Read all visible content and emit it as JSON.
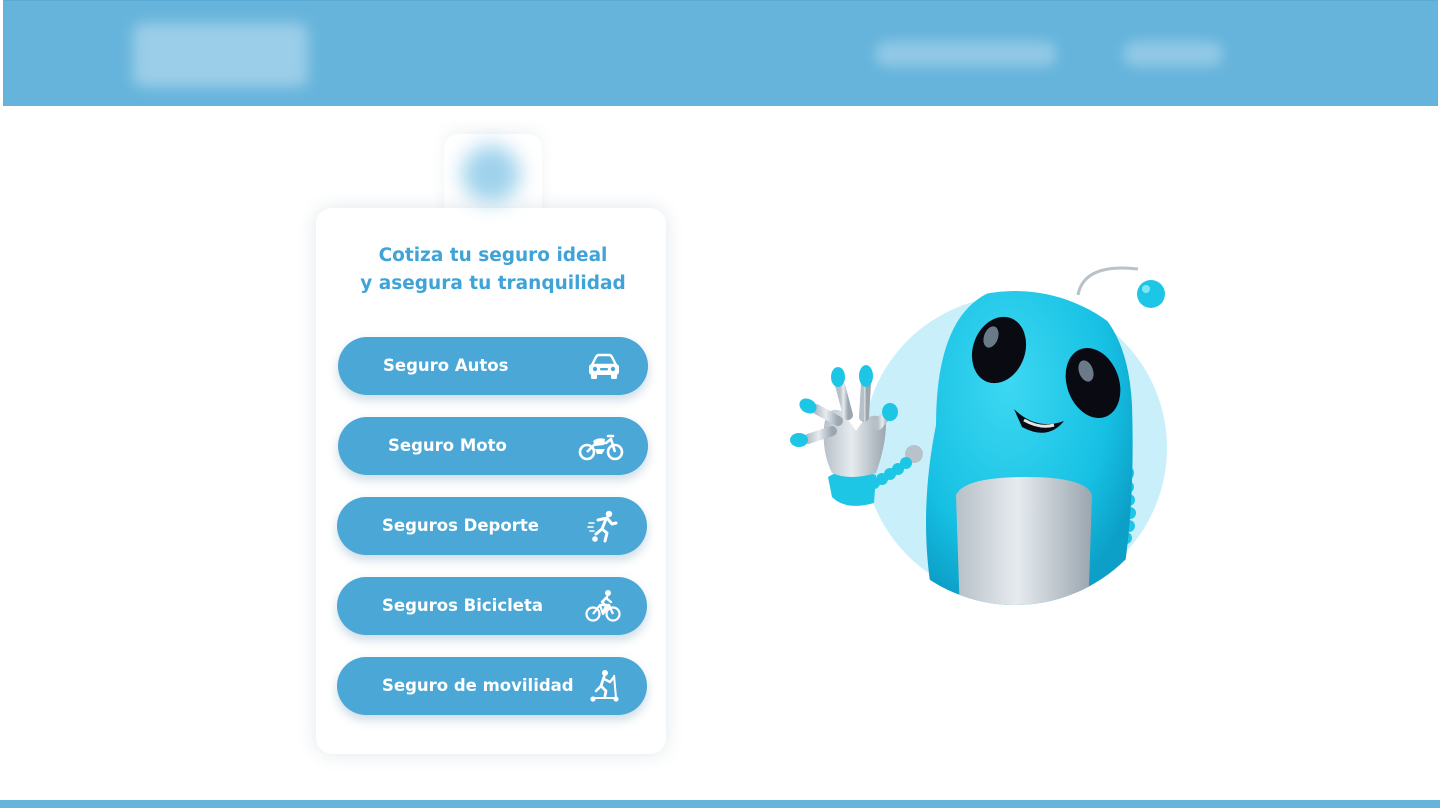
{
  "header": {
    "logo_icon": "blurred-logo",
    "nav_items": [
      "blurred-link",
      "blurred-link"
    ]
  },
  "card": {
    "tab_icon": "blurred-emblem",
    "title_line1": "Cotiza tu seguro ideal",
    "title_line2": "y asegura tu tranquilidad",
    "buttons": [
      {
        "label": "Seguro Autos",
        "icon": "car-icon"
      },
      {
        "label": "Seguro Moto",
        "icon": "motorcycle-icon"
      },
      {
        "label": "Seguros Deporte",
        "icon": "soccer-player-icon"
      },
      {
        "label": "Seguros Bicicleta",
        "icon": "cyclist-icon"
      },
      {
        "label": "Seguro de movilidad",
        "icon": "scooter-icon"
      }
    ]
  },
  "mascot": {
    "icon": "robot-mascot-waving"
  },
  "colors": {
    "header": "#66b4dc",
    "button": "#4ba7d6",
    "title": "#3fa3d7",
    "mascot_body": "#1fc6e6",
    "mascot_circle": "#c9effb"
  }
}
